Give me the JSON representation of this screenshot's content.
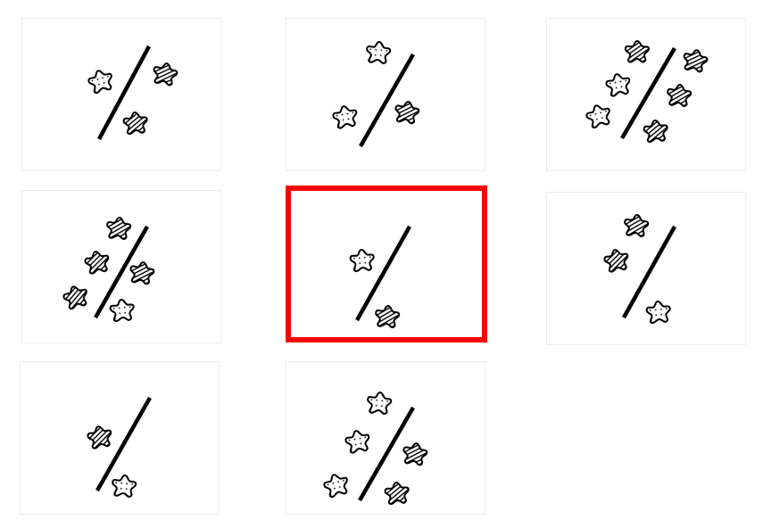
{
  "palette": {
    "stroke": "#000000",
    "panel_border": "#ececec",
    "selection": "#ff0000",
    "background": "#ffffff"
  },
  "panels": [
    {
      "id": "p1",
      "divider": "slash",
      "blobs": [
        "dots",
        "stripes",
        "stripes"
      ],
      "selected": false
    },
    {
      "id": "p2",
      "divider": "slash",
      "blobs": [
        "dots",
        "dots",
        "stripes"
      ],
      "selected": false
    },
    {
      "id": "p3",
      "divider": "slash",
      "blobs": [
        "stripes",
        "dots",
        "dots",
        "stripes",
        "stripes",
        "stripes"
      ],
      "selected": false
    },
    {
      "id": "p4",
      "divider": "slash",
      "blobs": [
        "stripes",
        "stripes",
        "stripes",
        "stripes",
        "dots"
      ],
      "selected": false
    },
    {
      "id": "p5",
      "divider": "slash",
      "blobs": [
        "dots",
        "stripes"
      ],
      "selected": true
    },
    {
      "id": "p6",
      "divider": "slash",
      "blobs": [
        "stripes",
        "stripes",
        "dots"
      ],
      "selected": false
    },
    {
      "id": "p7",
      "divider": "slash",
      "blobs": [
        "stripes",
        "dots"
      ],
      "selected": false
    },
    {
      "id": "p8",
      "divider": "slash",
      "blobs": [
        "dots",
        "dots",
        "stripes",
        "dots",
        "stripes"
      ],
      "selected": false
    }
  ]
}
